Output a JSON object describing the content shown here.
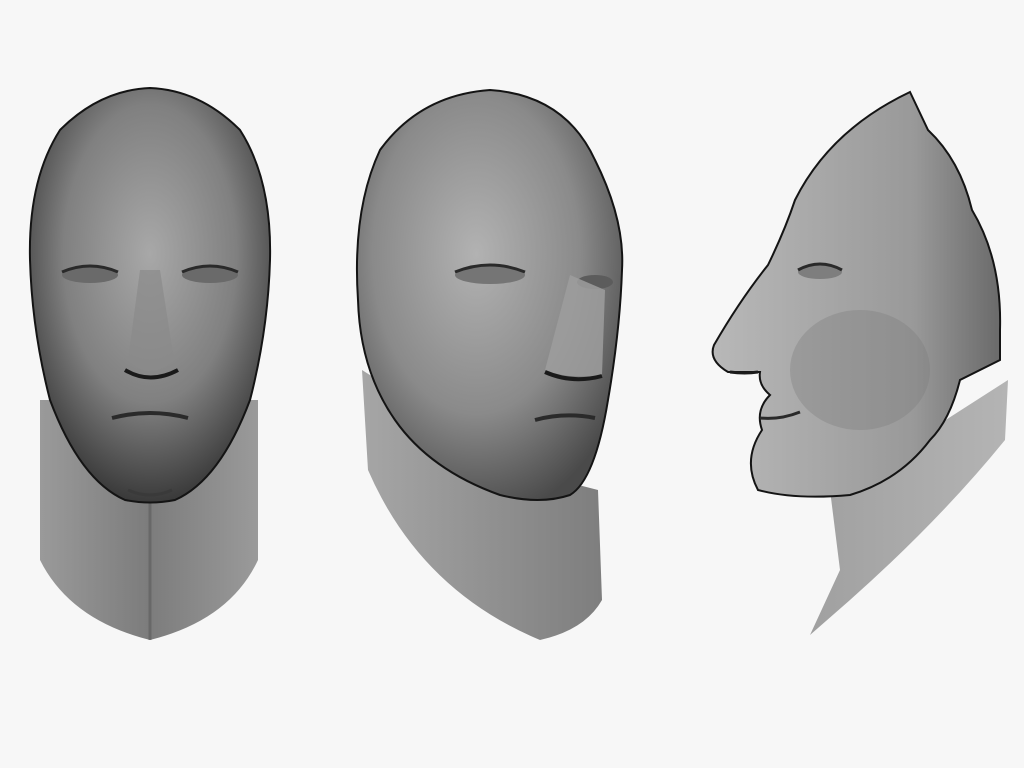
{
  "scene": {
    "background": "#f7f7f7",
    "subject": "3d-head-model",
    "material": "grey-clay",
    "views": [
      {
        "id": "front",
        "name": "front-view"
      },
      {
        "id": "three-quarter",
        "name": "three-quarter-view"
      },
      {
        "id": "profile",
        "name": "profile-view"
      }
    ]
  },
  "colors": {
    "light": "#c4c4c4",
    "mid": "#8e8e8e",
    "shadow": "#3a3a3a",
    "outline": "#141414"
  }
}
